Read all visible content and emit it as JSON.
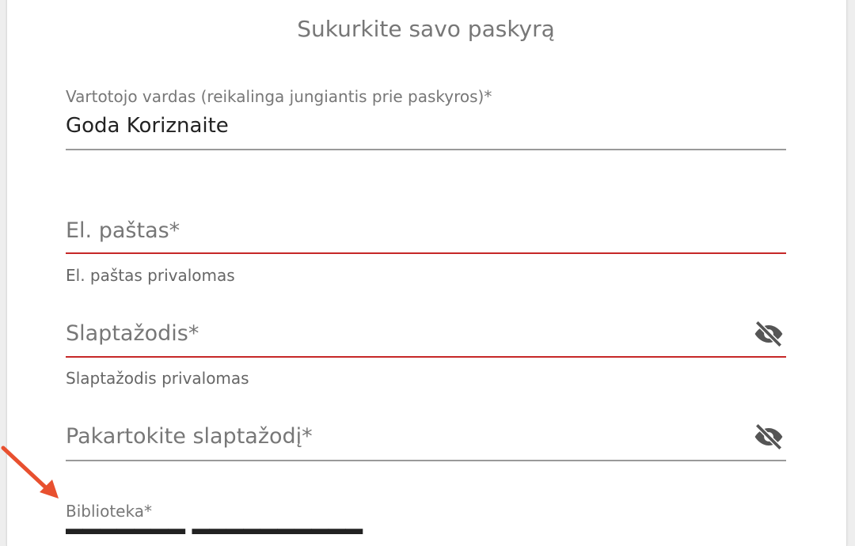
{
  "form": {
    "subtitle": "Sukurkite savo paskyrą",
    "username": {
      "label": "Vartotojo vardas (reikalinga jungiantis prie paskyros)*",
      "value": "Goda Koriznaite"
    },
    "email": {
      "placeholder": "El. paštas*",
      "error": "El. paštas privalomas"
    },
    "password": {
      "placeholder": "Slaptažodis*",
      "error": "Slaptažodis privalomas",
      "icon": "eye-off-icon"
    },
    "password_repeat": {
      "placeholder": "Pakartokite slaptažodį*",
      "icon": "eye-off-icon"
    },
    "library": {
      "label": "Biblioteka*"
    }
  },
  "colors": {
    "error": "#c62828",
    "annotation_arrow": "#e8502f"
  }
}
